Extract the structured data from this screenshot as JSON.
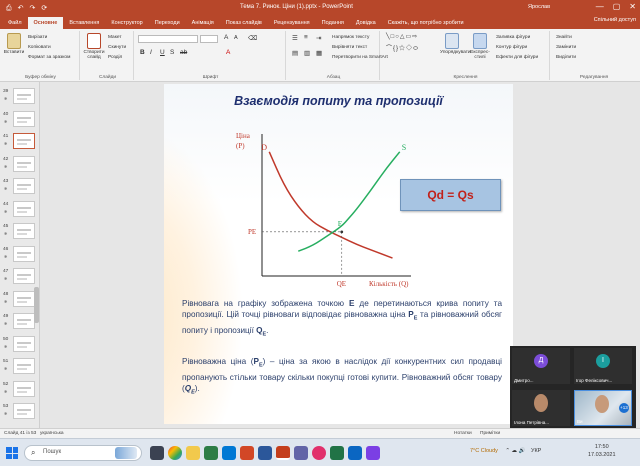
{
  "app": {
    "window_title": "Тема 7. Ринок. Ціни (1).pptx  -  PowerPoint",
    "user_name": "Ярослав",
    "quick_access": [
      "↶",
      "↷",
      "⟳",
      "⎙"
    ],
    "window_controls": [
      "—",
      "▢",
      "✕"
    ]
  },
  "ribbon_tabs": [
    "Файл",
    "Основне",
    "Вставлення",
    "Конструктор",
    "Переходи",
    "Анімація",
    "Показ слайдів",
    "Рецензування",
    "Подання",
    "Довідка"
  ],
  "ribbon": {
    "tell_me": "Скажіть, що потрібно зробити",
    "share_label": "Спільний доступ",
    "paste_label": "Вставити",
    "clipboard_items": [
      "Вирізати",
      "Копіювати",
      "Формат за зразком"
    ],
    "new_slide_label": "Створити слайд",
    "slides_items": [
      "Макет",
      "Скинути",
      "Розділ"
    ],
    "paragraph_items": [
      "Напрямок тексту",
      "Вирівняти текст",
      "Перетворити на SmartArt"
    ],
    "arrange_label": "Упорядкувати",
    "quick_styles_label": "Експрес-стилі",
    "shape_items": [
      "Заливка фігури",
      "Контур фігури",
      "Ефекти для фігури"
    ],
    "editing_items": [
      "Знайти",
      "Замінити",
      "Виділити"
    ],
    "group_names": [
      "Буфер обміну",
      "Слайди",
      "Шрифт",
      "Абзац",
      "Креслення",
      "Редагування"
    ]
  },
  "slides": {
    "numbers": [
      "39",
      "40",
      "41",
      "42",
      "43",
      "44",
      "45",
      "46",
      "47",
      "48",
      "49",
      "50",
      "51",
      "52",
      "53"
    ],
    "active_number": "41"
  },
  "slide": {
    "title": "Взаємодія попиту та  пропозиції",
    "equation": "Qd = Qs",
    "para1_a": "Рівновага на графіку зображена точкою ",
    "para1_e": "E",
    "para1_b": " де перетинаються крива попиту та пропозиції. Цій точці рівноваги відповідає рівноважна ціна ",
    "para1_pe": "P",
    "para1_pe_sub": "E",
    "para1_c": " та рівноважний обсяг попиту і пропозиції ",
    "para1_qe": "Q",
    "para1_qe_sub": "E",
    "para1_end": ".",
    "para2_a": "Рівноважна ціна (",
    "para2_pe": "P",
    "para2_pe_sub": "E",
    "para2_b": ") – ціна за якою в наслідок дії конкурентних сил продавці пропанують стільки товару скільки покупці готові купити. Рівноважний обсяг товару (",
    "para2_qe": "Q",
    "para2_qe_sub": "E",
    "para2_end": ")."
  },
  "chart_data": {
    "type": "line",
    "title": "",
    "ylabel": "Ціна (P)",
    "xlabel": "Кількість (Q)",
    "xlim": [
      0,
      10
    ],
    "ylim": [
      0,
      10
    ],
    "series": [
      {
        "name": "D",
        "x": [
          0.5,
          1.5,
          2.5,
          3.5,
          4.5,
          5.5,
          6.5,
          7.5,
          8.5,
          9.0
        ],
        "y": [
          9.0,
          6.6,
          5.0,
          3.9,
          3.3,
          2.8,
          2.3,
          1.9,
          1.5,
          1.3
        ]
      },
      {
        "name": "S",
        "x": [
          2.5,
          3.5,
          4.5,
          5.5,
          6.0,
          6.5,
          7.5,
          8.5,
          9.5
        ],
        "y": [
          1.8,
          2.2,
          2.9,
          3.6,
          4.2,
          4.8,
          6.2,
          7.7,
          9.0
        ]
      }
    ],
    "equilibrium": {
      "label": "E",
      "x": 5.5,
      "y": 3.2,
      "price_label": "PE",
      "quantity_label": "QE"
    },
    "grid": false,
    "colors": {
      "demand": "#c0392b",
      "supply": "#27ae60",
      "axis_text": "#c0392b"
    }
  },
  "video_call": {
    "participants": [
      {
        "initial": "Д",
        "name": "Дмитро...",
        "color": "#7c4dd8"
      },
      {
        "initial": "І",
        "name": "Ігор Феліксович...",
        "color": "#1b9e9e"
      },
      {
        "name": "Ілона Петрівна..."
      },
      {
        "name": "Ви",
        "extra_count": "+13"
      }
    ]
  },
  "status": {
    "slide_info": "Слайд 41 із 53",
    "language": "українська",
    "notes": "Нотатки",
    "comments": "Примітки"
  },
  "taskbar": {
    "search_placeholder": "Пошук",
    "weather": "7°C Cloudy",
    "lang": "УКР",
    "time": "17:50",
    "date": "17.03.2021"
  }
}
